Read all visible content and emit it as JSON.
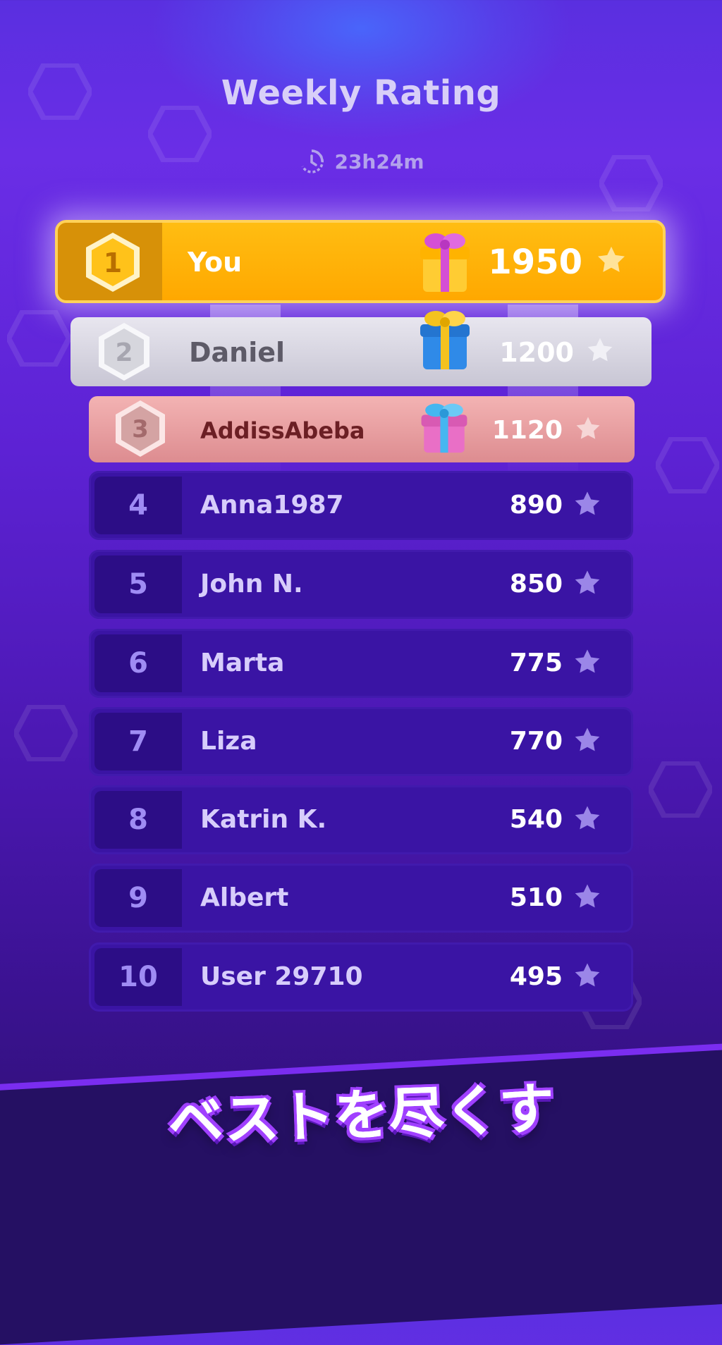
{
  "header": {
    "title": "Weekly Rating",
    "timer": "23h24m"
  },
  "leaderboard": [
    {
      "rank": "1",
      "name": "You",
      "score": "1950",
      "reward": "gift-purple"
    },
    {
      "rank": "2",
      "name": "Daniel",
      "score": "1200",
      "reward": "gift-blue"
    },
    {
      "rank": "3",
      "name": "AddissAbeba",
      "score": "1120",
      "reward": "gift-pink"
    },
    {
      "rank": "4",
      "name": "Anna1987",
      "score": "890"
    },
    {
      "rank": "5",
      "name": "John N.",
      "score": "850"
    },
    {
      "rank": "6",
      "name": "Marta",
      "score": "775"
    },
    {
      "rank": "7",
      "name": "Liza",
      "score": "770"
    },
    {
      "rank": "8",
      "name": "Katrin K.",
      "score": "540"
    },
    {
      "rank": "9",
      "name": "Albert",
      "score": "510"
    },
    {
      "rank": "10",
      "name": "User 29710",
      "score": "495"
    }
  ],
  "banner": {
    "text": "ベストを尽くす"
  },
  "colors": {
    "gold": "#ffb100",
    "silver": "#d8d6e2",
    "bronze": "#e9a2a5",
    "row": "#3a14a4",
    "background": "#5d22d4"
  }
}
